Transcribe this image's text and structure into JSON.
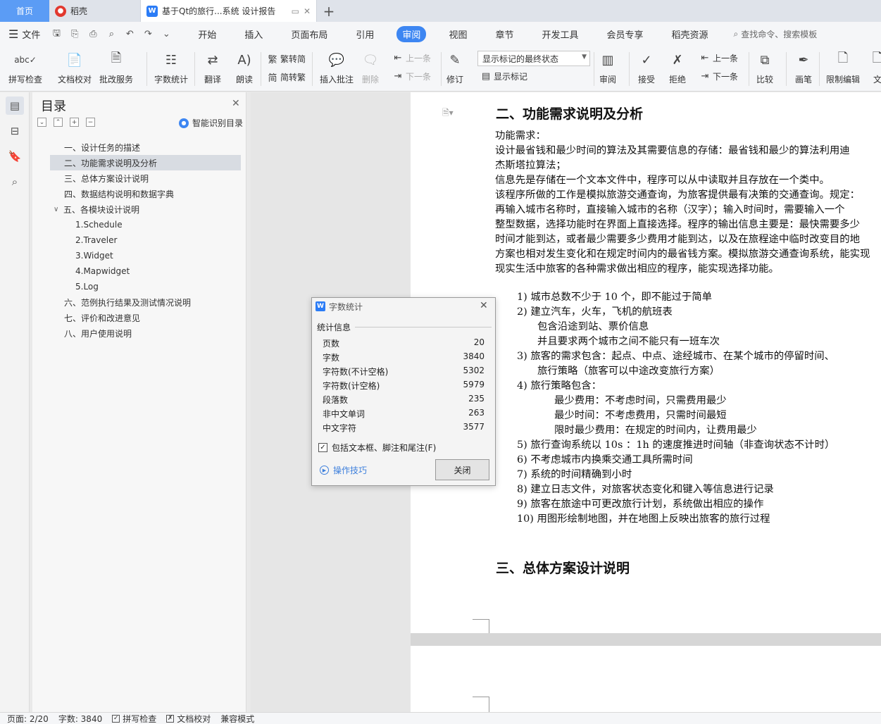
{
  "tabs": {
    "home": "首页",
    "daoke": "稻壳",
    "doc": "基于Qt的旅行...系统 设计报告"
  },
  "menubar": {
    "file": "文件",
    "items": [
      "开始",
      "插入",
      "页面布局",
      "引用",
      "审阅",
      "视图",
      "章节",
      "开发工具",
      "会员专享",
      "稻壳资源"
    ],
    "active": "审阅",
    "search": "查找命令、搜索模板"
  },
  "ribbon": {
    "spell": "拼写检查",
    "proofread": "文档校对",
    "annotate_service": "批改服务",
    "word_count": "字数统计",
    "translate": "翻译",
    "read_aloud": "朗读",
    "trad": "繁转简",
    "simp": "简转繁",
    "insert_comment": "插入批注",
    "delete": "删除",
    "prev1": "上一条",
    "next1": "下一条",
    "revise": "修订",
    "markup_select": "显示标记的最终状态",
    "show_markup": "显示标记",
    "review": "审阅",
    "accept": "接受",
    "reject": "拒绝",
    "prev2": "上一条",
    "next2": "下一条",
    "compare": "比较",
    "pen": "画笔",
    "restrict": "限制编辑",
    "doc_more": "文"
  },
  "toc": {
    "title": "目录",
    "smart": "智能识别目录",
    "items": [
      "一、设计任务的描述",
      "二、功能需求说明及分析",
      "三、总体方案设计说明",
      "四、数据结构说明和数据字典",
      "五、各模块设计说明",
      "1.Schedule",
      "2.Traveler",
      "3.Widget",
      "4.Mapwidget",
      "5.Log",
      "六、范例执行结果及测试情况说明",
      "七、评价和改进意见",
      "八、用户使用说明"
    ],
    "active_index": 1
  },
  "document": {
    "heading2": "二、功能需求说明及分析",
    "lines": [
      "功能需求：",
      "设计最省钱和最少时间的算法及其需要信息的存储：最省钱和最少的算法利用迪",
      "杰斯塔拉算法；",
      "信息先是存储在一个文本文件中，程序可以从中读取并且存放在一个类中。",
      "该程序所做的工作是模拟旅游交通查询，为旅客提供最有决策的交通查询。规定：",
      "再输入城市名称时，直接输入城市的名称（汉字）；输入时间时，需要输入一个",
      "整型数据，选择功能时在界面上直接选择。程序的输出信息主要是：最快需要多少",
      "时间才能到达，或者最少需要多少费用才能到达，以及在旅程途中临时改变目的地",
      "方案也相对发生变化和在规定时间内的最省钱方案。模拟旅游交通查询系统，能实现",
      "现实生活中旅客的各种需求做出相应的程序，能实现选择功能。"
    ],
    "list": [
      "1)  城市总数不少于 10 个，即不能过于简单",
      "2)  建立汽车，火车，飞机的航班表",
      "包含沿途到站、票价信息",
      "并且要求两个城市之间不能只有一班车次",
      "3)  旅客的需求包含：起点、中点、途经城市、在某个城市的停留时间、",
      "旅行策略（旅客可以中途改变旅行方案）",
      "4)  旅行策略包含：",
      "最少费用：不考虑时间，只需费用最少",
      "最少时间：不考虑费用，只需时间最短",
      "限时最少费用：在规定的时间内，让费用最少",
      "5)  旅行查询系统以 10s ：1h 的速度推进时间轴（非查询状态不计时）",
      "6)  不考虑城市内换乘交通工具所需时间",
      "7)  系统的时间精确到小时",
      "8)  建立日志文件，对旅客状态变化和键入等信息进行记录",
      "9)  旅客在旅途中可更改旅行计划，系统做出相应的操作",
      "10) 用图形绘制地图，并在地图上反映出旅客的旅行过程"
    ],
    "heading3": "三、总体方案设计说明"
  },
  "dialog": {
    "title": "字数统计",
    "section": "统计信息",
    "rows": [
      {
        "label": "页数",
        "value": "20"
      },
      {
        "label": "字数",
        "value": "3840"
      },
      {
        "label": "字符数(不计空格)",
        "value": "5302"
      },
      {
        "label": "字符数(计空格)",
        "value": "5979"
      },
      {
        "label": "段落数",
        "value": "235"
      },
      {
        "label": "非中文单词",
        "value": "263"
      },
      {
        "label": "中文字符",
        "value": "3577"
      }
    ],
    "include_label": "包括文本框、脚注和尾注(F)",
    "include_checked": true,
    "tips": "操作技巧",
    "close": "关闭"
  },
  "statusbar": {
    "page": "页面: 2/20",
    "words": "字数: 3840",
    "spell": "拼写检查",
    "proof": "文档校对",
    "compat": "兼容模式"
  },
  "colors": {
    "accent": "#3d86f2",
    "home_tab": "#5b9cf5"
  }
}
